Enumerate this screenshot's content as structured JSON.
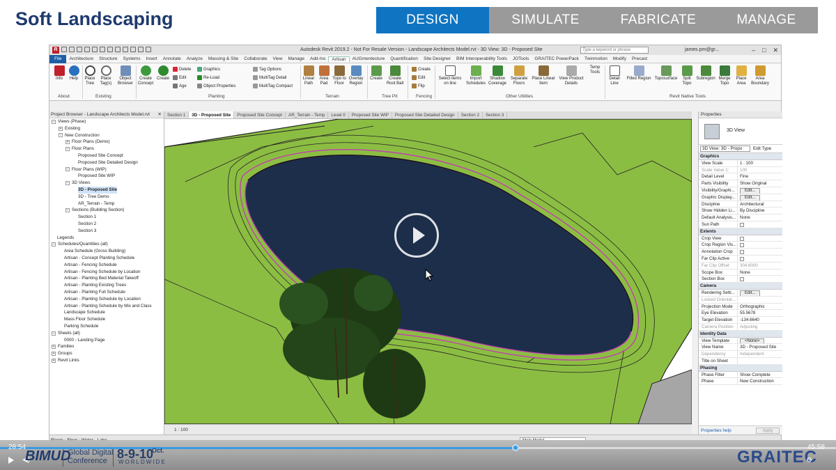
{
  "slide": {
    "title": "Soft Landscaping",
    "tabs": [
      "DESIGN",
      "SIMULATE",
      "FABRICATE",
      "MANAGE"
    ],
    "active_tab": "DESIGN"
  },
  "revit": {
    "window_title": "Autodesk Revit 2019.2 - Not For Resale Version - Landscape Architects Model.rvt - 3D View: 3D - Proposed Site",
    "search_placeholder": "Type a keyword or phrase",
    "user": "james.pm@gr...",
    "menu": [
      "File",
      "Architecture",
      "Structure",
      "Systems",
      "Insert",
      "Annotate",
      "Analyze",
      "Massing & Site",
      "Collaborate",
      "View",
      "Manage",
      "Add-Ins",
      "Artisan",
      "AUGmentecture",
      "Quantification",
      "Site Designer",
      "BIM Interoperability Tools",
      "JOTools",
      "GRAITEC PowerPack",
      "Twinmotion",
      "Modify",
      "Precast"
    ],
    "active_menu": "Artisan",
    "ribbon": {
      "about": [
        "Info",
        "Help"
      ],
      "existing": [
        "Place Tree",
        "Place Tag(s)",
        "Object Browser"
      ],
      "planting_large": [
        "Create Concept",
        "Create"
      ],
      "planting_small": [
        "Delete",
        "Edit",
        "Age",
        "Graphics",
        "Re-Load",
        "Object Properties"
      ],
      "tag_small": [
        "Tag Options",
        "MultiTag Detail",
        "MultiTag Compact"
      ],
      "terrain": [
        "Linear Path",
        "Area Pad",
        "Topo to Floor",
        "Overlay Region"
      ],
      "treepit": [
        "Create",
        "Create Root Ball"
      ],
      "fencing": [
        "Create",
        "Edit",
        "Flip"
      ],
      "other": [
        "Select items on line",
        "Import Schedules",
        "Shadow Coverage",
        "Separate Floors",
        "Place Linear Item",
        "View Product Details",
        "Temp Tools"
      ],
      "native": [
        "Detail Line",
        "Filled Region",
        "Toposurface",
        "Split Topo",
        "Subregion",
        "Merge Topo",
        "Place Area",
        "Area Boundary"
      ],
      "groups": [
        "About",
        "Existing",
        "Planting",
        "Terrain",
        "Tree Pit",
        "Fencing",
        "Other Utilities",
        "Revit Native Tools"
      ]
    },
    "browser": {
      "title": "Project Browser - Landscape Architects Model.rvt",
      "rows": [
        {
          "label": "Views (Phase)",
          "indent": 0,
          "exp": "-"
        },
        {
          "label": "Existing",
          "indent": 1,
          "exp": "+"
        },
        {
          "label": "New Construction",
          "indent": 1,
          "exp": "-"
        },
        {
          "label": "Floor Plans (Demo)",
          "indent": 2,
          "exp": "+"
        },
        {
          "label": "Floor Plans",
          "indent": 2,
          "exp": "-"
        },
        {
          "label": "Proposed Site Concept",
          "indent": 3,
          "exp": ""
        },
        {
          "label": "Proposed Site Detailed Design",
          "indent": 3,
          "exp": ""
        },
        {
          "label": "Floor Plans (WIP)",
          "indent": 2,
          "exp": "-"
        },
        {
          "label": "Proposed Site WIP",
          "indent": 3,
          "exp": ""
        },
        {
          "label": "3D Views",
          "indent": 2,
          "exp": "-"
        },
        {
          "label": "3D - Proposed Site",
          "indent": 3,
          "exp": "",
          "selected": true
        },
        {
          "label": "3D - Tree Demo",
          "indent": 3,
          "exp": ""
        },
        {
          "label": "AR_Terrain - Temp",
          "indent": 3,
          "exp": ""
        },
        {
          "label": "Sections (Building Section)",
          "indent": 2,
          "exp": "-"
        },
        {
          "label": "Section 1",
          "indent": 3,
          "exp": ""
        },
        {
          "label": "Section 2",
          "indent": 3,
          "exp": ""
        },
        {
          "label": "Section 3",
          "indent": 3,
          "exp": ""
        },
        {
          "label": "Legends",
          "indent": 0,
          "exp": ""
        },
        {
          "label": "Schedules/Quantities (all)",
          "indent": 0,
          "exp": "-"
        },
        {
          "label": "Area Schedule (Gross Building)",
          "indent": 1,
          "exp": ""
        },
        {
          "label": "Artisan - Concept Planting Schedule",
          "indent": 1,
          "exp": ""
        },
        {
          "label": "Artisan - Fencing Schedule",
          "indent": 1,
          "exp": ""
        },
        {
          "label": "Artisan - Fencing Schedule by Location",
          "indent": 1,
          "exp": ""
        },
        {
          "label": "Artisan - Planting Bed Material Takeoff",
          "indent": 1,
          "exp": ""
        },
        {
          "label": "Artisan - Planting Existing Trees",
          "indent": 1,
          "exp": ""
        },
        {
          "label": "Artisan - Planting Full Schedule",
          "indent": 1,
          "exp": ""
        },
        {
          "label": "Artisan - Planting Schedule by Location",
          "indent": 1,
          "exp": ""
        },
        {
          "label": "Artisan - Planting Schedule by Mix and Class",
          "indent": 1,
          "exp": ""
        },
        {
          "label": "Landscape Schedule",
          "indent": 1,
          "exp": ""
        },
        {
          "label": "Mass Floor Schedule",
          "indent": 1,
          "exp": ""
        },
        {
          "label": "Parking Schedule",
          "indent": 1,
          "exp": ""
        },
        {
          "label": "Sheets (all)",
          "indent": 0,
          "exp": "-"
        },
        {
          "label": "0000 - Landing Page",
          "indent": 1,
          "exp": ""
        },
        {
          "label": "Families",
          "indent": 0,
          "exp": "+"
        },
        {
          "label": "Groups",
          "indent": 0,
          "exp": "+"
        },
        {
          "label": "Revit Links",
          "indent": 0,
          "exp": "+"
        }
      ]
    },
    "view_tabs": [
      "Section 1",
      "3D - Proposed Site",
      "Proposed Site Concept",
      "AR_Terrain - Temp",
      "Level 0",
      "Proposed Site WIP",
      "Proposed Site Detailed Design",
      "Section 2",
      "Section 3"
    ],
    "active_view_tab": "3D - Proposed Site",
    "view_scale_label": "1 : 100",
    "properties": {
      "title": "Properties",
      "type_name": "3D View",
      "view_selector": "3D View: 3D - Propo",
      "edit_type": "Edit Type",
      "sections": [
        {
          "name": "Graphics",
          "rows": [
            {
              "k": "View Scale",
              "v": "1 : 100"
            },
            {
              "k": "Scale Value 1:",
              "v": "100",
              "dim": true
            },
            {
              "k": "Detail Level",
              "v": "Fine"
            },
            {
              "k": "Parts Visibility",
              "v": "Show Original"
            },
            {
              "k": "Visibility/Graphi...",
              "v": "Edit...",
              "btn": true
            },
            {
              "k": "Graphic Display...",
              "v": "Edit...",
              "btn": true
            },
            {
              "k": "Discipline",
              "v": "Architectural"
            },
            {
              "k": "Show Hidden Li...",
              "v": "By Discipline"
            },
            {
              "k": "Default Analysis...",
              "v": "None"
            },
            {
              "k": "Sun Path",
              "v": "",
              "chk": true
            }
          ]
        },
        {
          "name": "Extents",
          "rows": [
            {
              "k": "Crop View",
              "v": "",
              "chk": true
            },
            {
              "k": "Crop Region Vis...",
              "v": "",
              "chk": true
            },
            {
              "k": "Annotation Crop",
              "v": "",
              "chk": true
            },
            {
              "k": "Far Clip Active",
              "v": "",
              "chk": true
            },
            {
              "k": "Far Clip Offset",
              "v": "304.8000",
              "dim": true
            },
            {
              "k": "Scope Box",
              "v": "None"
            },
            {
              "k": "Section Box",
              "v": "",
              "chk": true
            }
          ]
        },
        {
          "name": "Camera",
          "rows": [
            {
              "k": "Rendering Setti...",
              "v": "Edit...",
              "btn": true
            },
            {
              "k": "Locked Orientat...",
              "v": "",
              "dim": true
            },
            {
              "k": "Projection Mode",
              "v": "Orthographic"
            },
            {
              "k": "Eye Elevation",
              "v": "55.5678"
            },
            {
              "k": "Target Elevation",
              "v": "-134.6640"
            },
            {
              "k": "Camera Position",
              "v": "Adjusting",
              "dim": true
            }
          ]
        },
        {
          "name": "Identity Data",
          "rows": [
            {
              "k": "View Template",
              "v": "<None>",
              "btn": true
            },
            {
              "k": "View Name",
              "v": "3D - Proposed Site"
            },
            {
              "k": "Dependency",
              "v": "Independent",
              "dim": true
            },
            {
              "k": "Title on Sheet",
              "v": ""
            }
          ]
        },
        {
          "name": "Phasing",
          "rows": [
            {
              "k": "Phase Filter",
              "v": "Show Complete"
            },
            {
              "k": "Phase",
              "v": "New Construction"
            }
          ]
        }
      ],
      "help_link": "Properties help",
      "apply": "Apply"
    },
    "status_text": "Floors : Floor : Water - Lake",
    "status_model": "Main Model"
  },
  "video": {
    "time_current": "28:54",
    "time_total": "45:58",
    "progress": 0.617,
    "event_logo": "BIMUD",
    "event_name_1": "Global Digital",
    "event_name_2": "Conference",
    "event_dates": "8-9-10",
    "event_month": "Oct.",
    "event_scope": "WORLDWIDE",
    "sponsor_logo": "GRAITEC"
  }
}
